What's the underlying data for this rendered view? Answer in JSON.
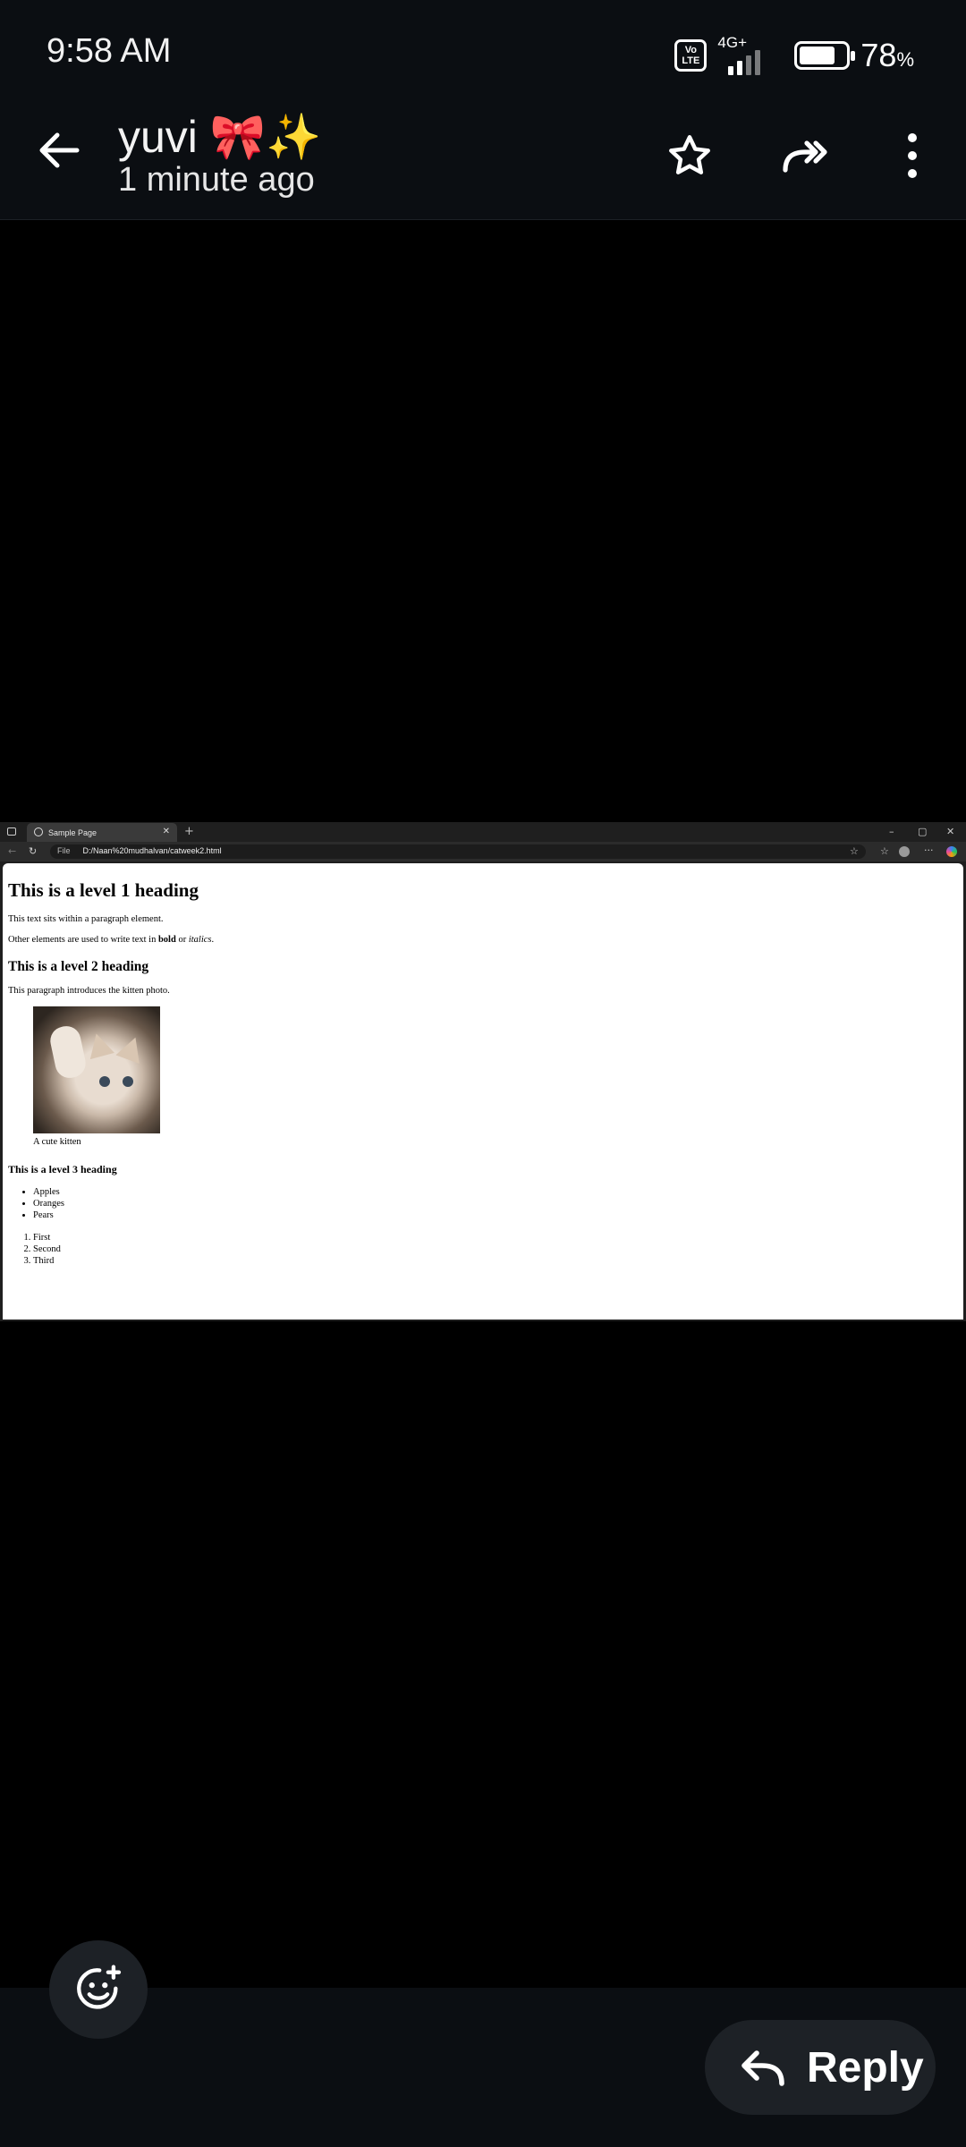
{
  "status": {
    "time": "9:58 AM",
    "volte": "Vo LTE",
    "network": "4G+",
    "battery_percent": "78",
    "battery_unit": "%",
    "battery_level": 0.78
  },
  "header": {
    "sender": "yuvi 🎀✨",
    "timestamp": "1 minute ago",
    "icons": [
      "back-arrow-icon",
      "star-icon",
      "forward-icon",
      "more-vert-icon"
    ]
  },
  "browser": {
    "tab_title": "Sample Page",
    "url_scheme": "File",
    "url": "D:/Naan%20mudhalvan/catweek2.html"
  },
  "webpage": {
    "h1": "This is a level 1 heading",
    "p1": "This text sits within a paragraph element.",
    "p2_prefix": "Other elements are used to write text in ",
    "p2_bold": "bold",
    "p2_mid": " or ",
    "p2_italic": "italics",
    "p2_suffix": ".",
    "h2": "This is a level 2 heading",
    "p3": "This paragraph introduces the kitten photo.",
    "caption": "A cute kitten",
    "h3": "This is a level 3 heading",
    "unordered": [
      "Apples",
      "Oranges",
      "Pears"
    ],
    "ordered": [
      "First",
      "Second",
      "Third"
    ]
  },
  "footer": {
    "reply_label": "Reply",
    "icons": [
      "add-reaction-icon",
      "reply-icon"
    ]
  }
}
